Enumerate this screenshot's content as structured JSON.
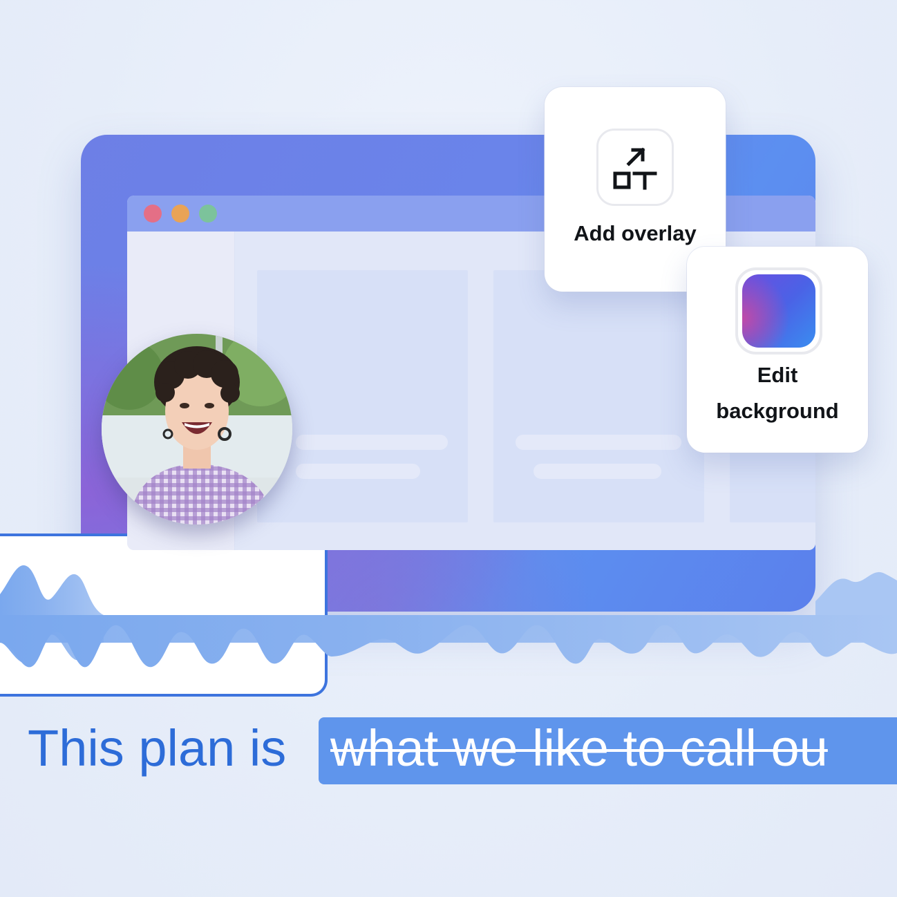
{
  "overlay_card": {
    "label": "Add overlay",
    "icon": "overlay-text-icon"
  },
  "background_card": {
    "label_line1": "Edit",
    "label_line2": "background",
    "icon": "gradient-background-icon"
  },
  "window": {
    "traffic_lights": [
      "#e46f86",
      "#e9a356",
      "#7cc39b"
    ]
  },
  "caption": {
    "prefix": "This plan is",
    "struck_text": "what we like to call ou"
  },
  "colors": {
    "accent": "#3d74de",
    "caption_text": "#2d6cd8",
    "highlight": "#5f95ec"
  }
}
